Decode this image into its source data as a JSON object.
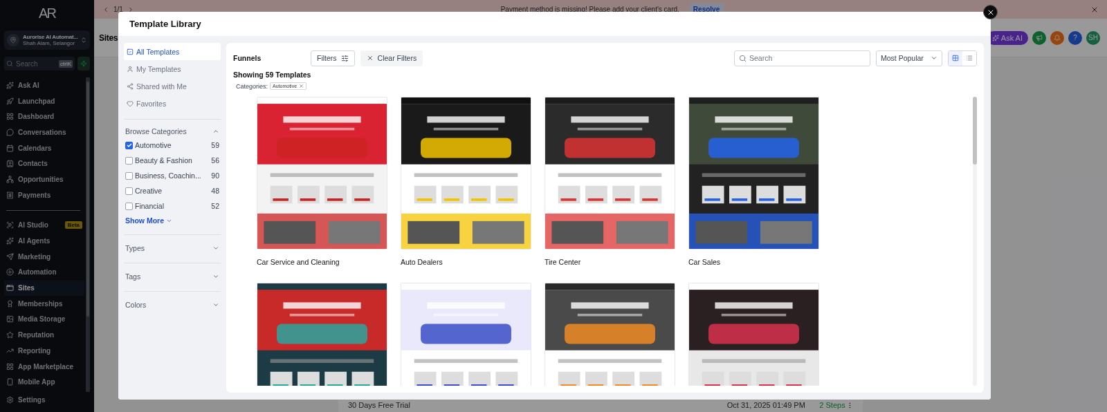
{
  "banner": {
    "pager": "1/1",
    "message": "Payment method is missing! Please add your client's card.",
    "action": "Resolve"
  },
  "sidebar": {
    "logo": "AR",
    "account": {
      "name": "Aurorise AI Automat...",
      "location": "Shah Alam, Selangor"
    },
    "search": {
      "placeholder": "Search",
      "shortcut": "ctrlK"
    },
    "groups": [
      [
        {
          "label": "Ask AI",
          "selected": false
        },
        {
          "label": "Launchpad",
          "selected": false
        },
        {
          "label": "Dashboard",
          "selected": false
        },
        {
          "label": "Conversations",
          "selected": false
        },
        {
          "label": "Calendars",
          "selected": false
        },
        {
          "label": "Contacts",
          "selected": false
        },
        {
          "label": "Opportunities",
          "selected": false
        },
        {
          "label": "Payments",
          "selected": false
        }
      ],
      [
        {
          "label": "AI Studio",
          "badge": "Beta",
          "selected": false
        },
        {
          "label": "AI Agents",
          "selected": false
        },
        {
          "label": "Marketing",
          "selected": false
        },
        {
          "label": "Automation",
          "selected": false
        },
        {
          "label": "Sites",
          "selected": true
        },
        {
          "label": "Memberships",
          "selected": false
        },
        {
          "label": "Media Storage",
          "selected": false
        },
        {
          "label": "Reputation",
          "selected": false
        },
        {
          "label": "Reporting",
          "selected": false
        },
        {
          "label": "App Marketplace",
          "selected": false
        },
        {
          "label": "Mobile App",
          "selected": false
        }
      ]
    ],
    "footer": {
      "label": "Settings"
    }
  },
  "page": {
    "title": "Sites",
    "ask_ai": "Ask AI",
    "avatar": "SH",
    "help": "?",
    "row": {
      "name": "30 Days Free Trial",
      "date": "Oct 31, 2025 01:49 PM",
      "steps": "2 Steps"
    }
  },
  "modal": {
    "title": "Template Library",
    "nav": [
      {
        "label": "All Templates",
        "selected": true
      },
      {
        "label": "My Templates",
        "selected": false
      },
      {
        "label": "Shared with Me",
        "selected": false
      },
      {
        "label": "Favorites",
        "selected": false
      }
    ],
    "categories": {
      "title": "Browse Categories",
      "expanded": true,
      "items": [
        {
          "label": "Automotive",
          "count": "59",
          "checked": true
        },
        {
          "label": "Beauty & Fashion",
          "count": "56",
          "checked": false
        },
        {
          "label": "Business, Coachin...",
          "count": "90",
          "checked": false
        },
        {
          "label": "Creative",
          "count": "48",
          "checked": false
        },
        {
          "label": "Financial",
          "count": "52",
          "checked": false
        }
      ],
      "more": "Show More"
    },
    "sections": [
      {
        "title": "Types",
        "expanded": false
      },
      {
        "title": "Tags",
        "expanded": false
      },
      {
        "title": "Colors",
        "expanded": false
      }
    ],
    "toolbar": {
      "type": "Funnels",
      "filters": "Filters",
      "clear": "Clear Filters",
      "search_placeholder": "Search",
      "sort": "Most Popular",
      "views": [
        {
          "kind": "grid",
          "selected": true
        },
        {
          "kind": "list",
          "selected": false
        }
      ]
    },
    "summary": "Showing 59 Templates",
    "applied": {
      "label": "Categories:",
      "chips": [
        "Automotive"
      ]
    },
    "templates": [
      {
        "kind": "funnel",
        "title": "Car Service and Cleaning"
      },
      {
        "kind": "funnel",
        "title": "Auto Dealers"
      },
      {
        "kind": "funnel",
        "title": "Tire Center"
      },
      {
        "kind": "funnel",
        "title": "Car Sales"
      },
      {
        "kind": "funnel"
      },
      {
        "kind": "funnel"
      },
      {
        "kind": "funnel"
      },
      {
        "kind": "funnel"
      }
    ]
  }
}
